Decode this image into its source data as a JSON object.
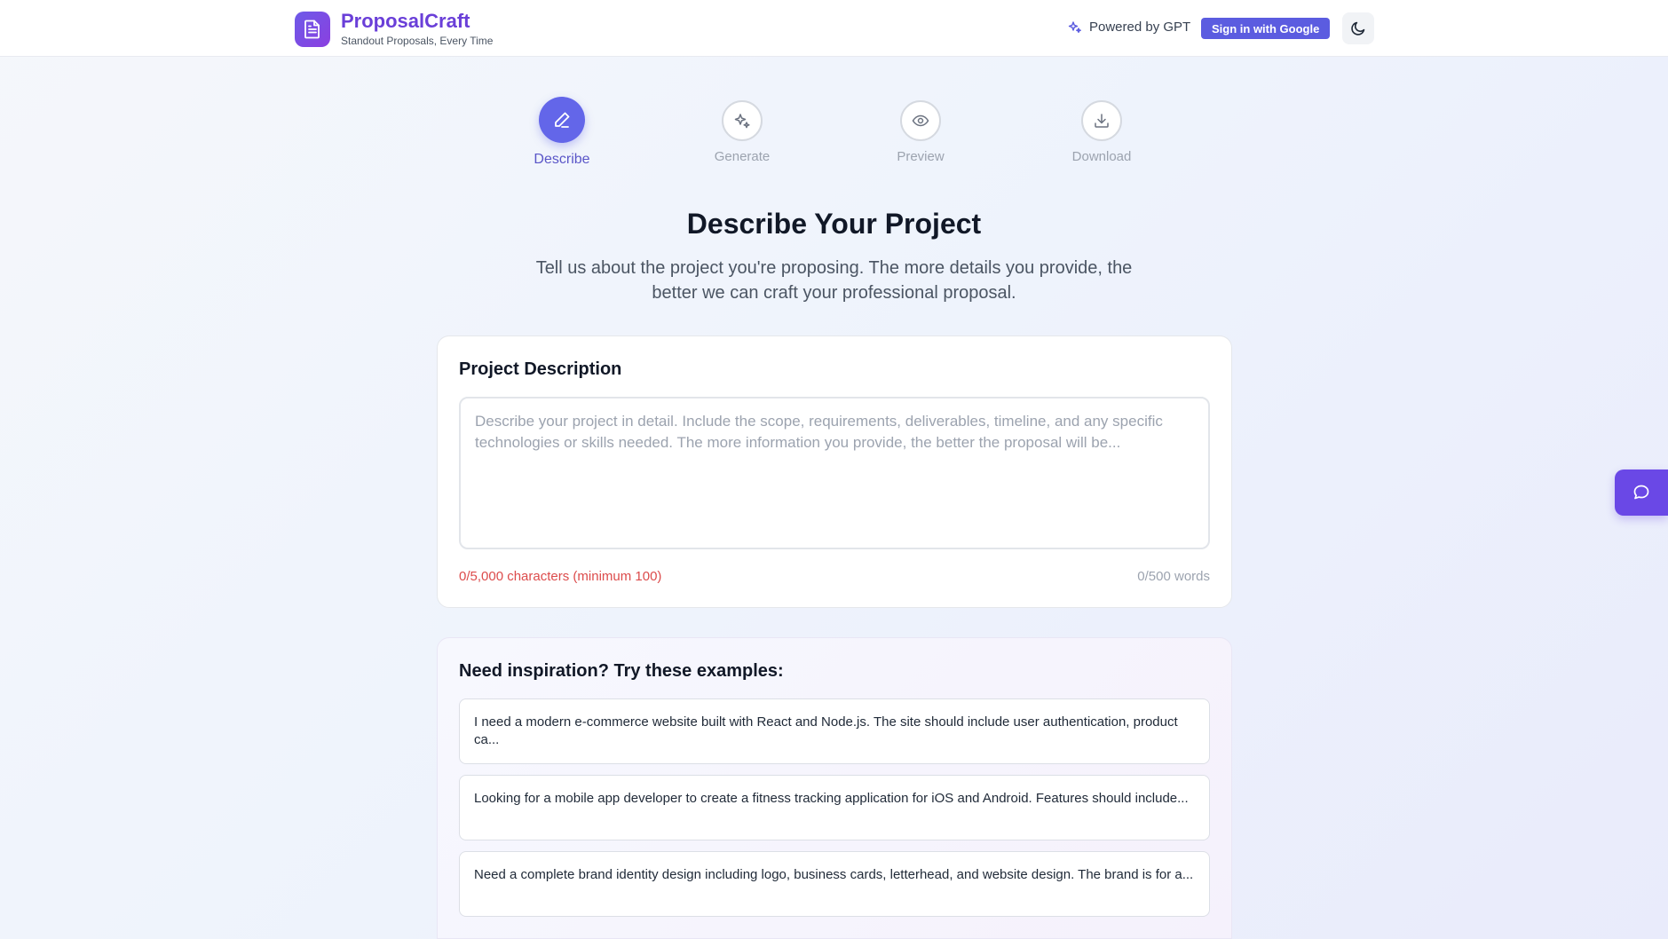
{
  "header": {
    "brand_name": "ProposalCraft",
    "brand_tagline": "Standout Proposals, Every Time",
    "powered_by": "Powered by GPT",
    "signin_label": "Sign in with Google"
  },
  "steps": [
    {
      "label": "Describe",
      "icon": "pencil-icon",
      "active": true
    },
    {
      "label": "Generate",
      "icon": "sparkles-icon",
      "active": false
    },
    {
      "label": "Preview",
      "icon": "eye-icon",
      "active": false
    },
    {
      "label": "Download",
      "icon": "download-icon",
      "active": false
    }
  ],
  "main": {
    "title": "Describe Your Project",
    "subtitle": "Tell us about the project you're proposing. The more details you provide, the better we can craft your professional proposal."
  },
  "description_card": {
    "title": "Project Description",
    "placeholder": "Describe your project in detail. Include the scope, requirements, deliverables, timeline, and any specific technologies or skills needed. The more information you provide, the better the proposal will be...",
    "value": "",
    "char_count": "0/5,000 characters (minimum 100)",
    "word_count": "0/500 words"
  },
  "examples_card": {
    "title": "Need inspiration? Try these examples:",
    "items": [
      "I need a modern e-commerce website built with React and Node.js. The site should include user authentication, product ca...",
      "Looking for a mobile app developer to create a fitness tracking application for iOS and Android. Features should include...",
      "Need a complete brand identity design including logo, business cards, letterhead, and website design. The brand is for a..."
    ]
  },
  "colors": {
    "accent": "#6366e9",
    "brand": "#6a3fd8",
    "error": "#dc4b4b",
    "chat_tab": "#6a48e6"
  }
}
